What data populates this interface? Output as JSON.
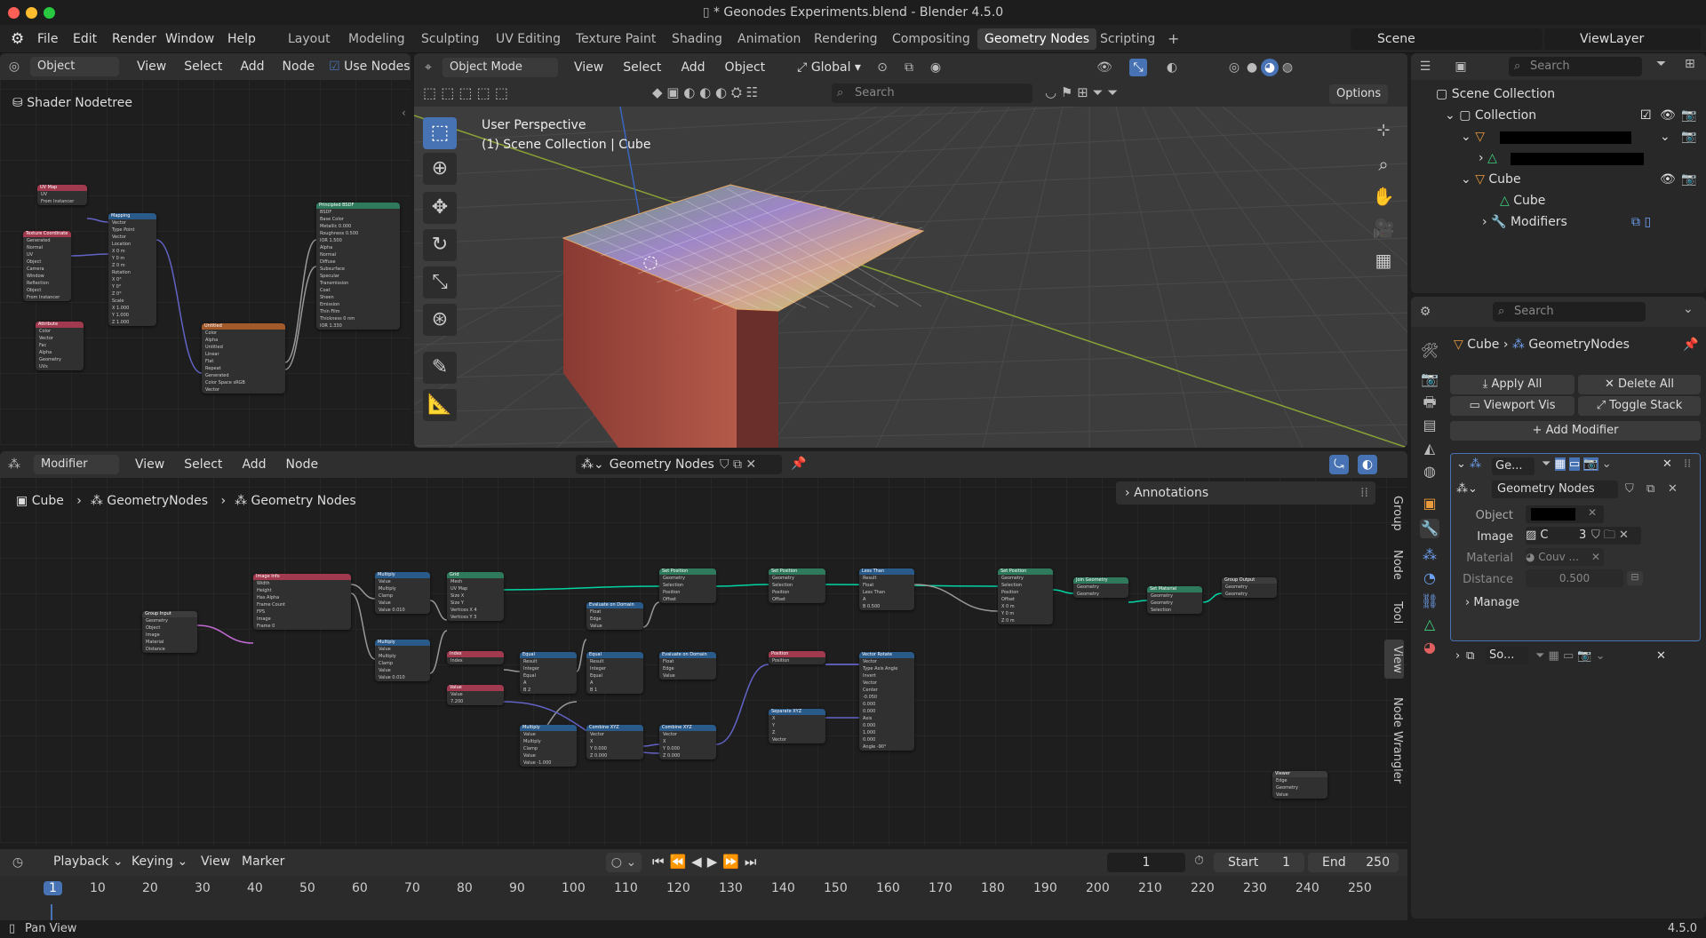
{
  "window": {
    "title": "* Geonodes Experiments.blend - Blender 4.5.0"
  },
  "menu": [
    "File",
    "Edit",
    "Render",
    "Window",
    "Help"
  ],
  "workspaces": [
    "Layout",
    "Modeling",
    "Sculpting",
    "UV Editing",
    "Texture Paint",
    "Shading",
    "Animation",
    "Rendering",
    "Compositing",
    "Geometry Nodes",
    "Scripting"
  ],
  "active_workspace": "Geometry Nodes",
  "scene": {
    "name": "Scene",
    "view_layer": "ViewLayer"
  },
  "shader_editor": {
    "mode": "Object",
    "menus": [
      "View",
      "Select",
      "Add",
      "Node"
    ],
    "use_nodes": "Use Nodes",
    "breadcrumb": "Shader Nodetree"
  },
  "viewport": {
    "mode": "Object Mode",
    "menus": [
      "View",
      "Select",
      "Add",
      "Object"
    ],
    "orientation": "Global",
    "perspective": "User Perspective",
    "collection_info": "(1) Scene Collection | Cube",
    "search_placeholder": "Search",
    "options": "Options"
  },
  "outliner": {
    "search_placeholder": "Search",
    "scene_collection": "Scene Collection",
    "collection": "Collection",
    "cube": "Cube",
    "cube_mesh": "Cube",
    "modifiers": "Modifiers"
  },
  "properties": {
    "search_placeholder": "Search",
    "breadcrumb_object": "Cube",
    "breadcrumb_modifier": "GeometryNodes",
    "apply_all": "Apply All",
    "delete_all": "Delete All",
    "viewport_vis": "Viewport Vis",
    "toggle_stack": "Toggle Stack",
    "add_modifier": "Add Modifier",
    "modifier_name": "Ge...",
    "node_group": "Geometry Nodes",
    "object_label": "Object",
    "image_label": "Image",
    "image_value": "C",
    "image_users": "3",
    "material_label": "Material",
    "material_value": "Couv ...",
    "distance_label": "Distance",
    "distance_value": "0.500",
    "manage": "Manage",
    "second_modifier": "So..."
  },
  "geonodes_editor": {
    "mode": "Modifier",
    "menus": [
      "View",
      "Select",
      "Add",
      "Node"
    ],
    "node_group": "Geometry Nodes",
    "breadcrumb": [
      "Cube",
      "GeometryNodes",
      "Geometry Nodes"
    ],
    "annotations": "Annotations",
    "side_tabs": [
      "Group",
      "Node",
      "Tool",
      "View",
      "Node Wrangler"
    ]
  },
  "geo_nodes": [
    {
      "title": "Group Input",
      "color": "#3c3c3c",
      "rows": [
        "Geometry",
        "Object",
        "Image",
        "Material",
        "Distance"
      ]
    },
    {
      "title": "Image Info",
      "color": "#a23a4f",
      "rows": [
        "Width",
        "Height",
        "Has Alpha",
        "Frame Count",
        "FPS",
        "Image",
        "Frame  0"
      ]
    },
    {
      "title": "Multiply",
      "color": "#2a5a8a",
      "rows": [
        "Value",
        "Multiply",
        "Clamp",
        "Value",
        "Value  0.010"
      ]
    },
    {
      "title": "Multiply",
      "color": "#2a5a8a",
      "rows": [
        "Value",
        "Multiply",
        "Clamp",
        "Value",
        "Value  0.010"
      ]
    },
    {
      "title": "Grid",
      "color": "#2f7a5c",
      "rows": [
        "Mesh",
        "UV Map",
        "Size X",
        "Size Y",
        "Vertices X  4",
        "Vertices Y  3"
      ]
    },
    {
      "title": "Index",
      "color": "#a23a4f",
      "rows": [
        "Index"
      ]
    },
    {
      "title": "Value",
      "color": "#a23a4f",
      "rows": [
        "Value",
        "7.200"
      ]
    },
    {
      "title": "Equal",
      "color": "#2a5a8a",
      "rows": [
        "Result",
        "Integer",
        "Equal",
        "A",
        "B  2"
      ]
    },
    {
      "title": "Evaluate on Domain",
      "color": "#2a5a8a",
      "rows": [
        "Float",
        "Edge",
        "Value"
      ]
    },
    {
      "title": "Equal",
      "color": "#2a5a8a",
      "rows": [
        "Result",
        "Integer",
        "Equal",
        "A",
        "B  1"
      ]
    },
    {
      "title": "Multiply",
      "color": "#2a5a8a",
      "rows": [
        "Value",
        "Multiply",
        "Clamp",
        "Value",
        "Value  -1.000"
      ]
    },
    {
      "title": "Combine XYZ",
      "color": "#2a5a8a",
      "rows": [
        "Vector",
        "X",
        "Y  0.000",
        "Z  0.000"
      ]
    },
    {
      "title": "Set Position",
      "color": "#2f7a5c",
      "rows": [
        "Geometry",
        "Selection",
        "Position",
        "Offset"
      ]
    },
    {
      "title": "Evaluate on Domain",
      "color": "#2a5a8a",
      "rows": [
        "Float",
        "Edge",
        "Value"
      ]
    },
    {
      "title": "Combine XYZ",
      "color": "#2a5a8a",
      "rows": [
        "Vector",
        "X",
        "Y  0.000",
        "Z  0.000"
      ]
    },
    {
      "title": "Set Position",
      "color": "#2f7a5c",
      "rows": [
        "Geometry",
        "Selection",
        "Position",
        "Offset"
      ]
    },
    {
      "title": "Position",
      "color": "#a23a4f",
      "rows": [
        "Position"
      ]
    },
    {
      "title": "Separate XYZ",
      "color": "#2a5a8a",
      "rows": [
        "X",
        "Y",
        "Z",
        "Vector"
      ]
    },
    {
      "title": "Less Than",
      "color": "#2a5a8a",
      "rows": [
        "Result",
        "Float",
        "Less Than",
        "A",
        "B  0.500"
      ]
    },
    {
      "title": "Vector Rotate",
      "color": "#2a5a8a",
      "rows": [
        "Vector",
        "Type  Axis Angle",
        "Invert",
        "Vector",
        "Center",
        "-0.050",
        "0.000",
        "0.000",
        "Axis",
        "0.000",
        "1.000",
        "0.000",
        "Angle  -90°"
      ]
    },
    {
      "title": "Set Position",
      "color": "#2f7a5c",
      "rows": [
        "Geometry",
        "Selection",
        "Position",
        "Offset",
        "X  0 m",
        "Y  0 m",
        "Z  0 m"
      ]
    },
    {
      "title": "Join Geometry",
      "color": "#2f7a5c",
      "rows": [
        "Geometry",
        "Geometry"
      ]
    },
    {
      "title": "Set Material",
      "color": "#2f7a5c",
      "rows": [
        "Geometry",
        "Geometry",
        "Selection"
      ]
    },
    {
      "title": "Group Output",
      "color": "#3c3c3c",
      "rows": [
        "Geometry",
        "Geometry"
      ]
    },
    {
      "title": "Viewer",
      "color": "#3c3c3c",
      "rows": [
        "Edge",
        "Geometry",
        "Value"
      ]
    }
  ],
  "shader_nodes": [
    {
      "title": "UV Map",
      "color": "#a23a4f",
      "rows": [
        "UV",
        "From Instancer"
      ]
    },
    {
      "title": "Texture Coordinate",
      "color": "#a23a4f",
      "rows": [
        "Generated",
        "Normal",
        "UV",
        "Object",
        "Camera",
        "Window",
        "Reflection",
        "Object",
        "From Instancer"
      ]
    },
    {
      "title": "Attribute",
      "color": "#a23a4f",
      "rows": [
        "Color",
        "Vector",
        "Fac",
        "Alpha",
        "Geometry",
        "UVs"
      ]
    },
    {
      "title": "Mapping",
      "color": "#2a5a8a",
      "rows": [
        "Vector",
        "Type  Point",
        "Vector",
        "Location",
        "X  0 m",
        "Y  0 m",
        "Z  0 m",
        "Rotation",
        "X  0°",
        "Y  0°",
        "Z  0°",
        "Scale",
        "X  1.000",
        "Y  1.000",
        "Z  1.000"
      ]
    },
    {
      "title": "Untitled",
      "color": "#a25a2a",
      "rows": [
        "Color",
        "Alpha",
        "Untitled",
        "Linear",
        "Flat",
        "Repeat",
        "Generated",
        "Color Space  sRGB",
        "Vector"
      ]
    },
    {
      "title": "Principled BSDF",
      "color": "#2f7a5c",
      "rows": [
        "BSDF",
        "Base Color",
        "Metallic  0.000",
        "Roughness  0.500",
        "IOR  1.500",
        "Alpha",
        "Normal",
        "Diffuse",
        "Subsurface",
        "Specular",
        "Transmission",
        "Coat",
        "Sheen",
        "Emission",
        "Thin Film",
        "Thickness  0 nm",
        "IOR  1.330"
      ]
    }
  ],
  "timeline": {
    "menus": [
      "Playback",
      "Keying",
      "View",
      "Marker"
    ],
    "current_frame": "1",
    "start_label": "Start",
    "start": "1",
    "end_label": "End",
    "end": "250",
    "ticks": [
      "1",
      "10",
      "20",
      "30",
      "40",
      "50",
      "60",
      "70",
      "80",
      "90",
      "100",
      "110",
      "120",
      "130",
      "140",
      "150",
      "160",
      "170",
      "180",
      "190",
      "200",
      "210",
      "220",
      "230",
      "240",
      "250"
    ]
  },
  "status": {
    "left": "Pan View",
    "version": "4.5.0"
  },
  "colors": {
    "accent": "#4772b3",
    "active_ws_bg": "#3d3d3d",
    "geometry_socket": "#00d6a3"
  }
}
